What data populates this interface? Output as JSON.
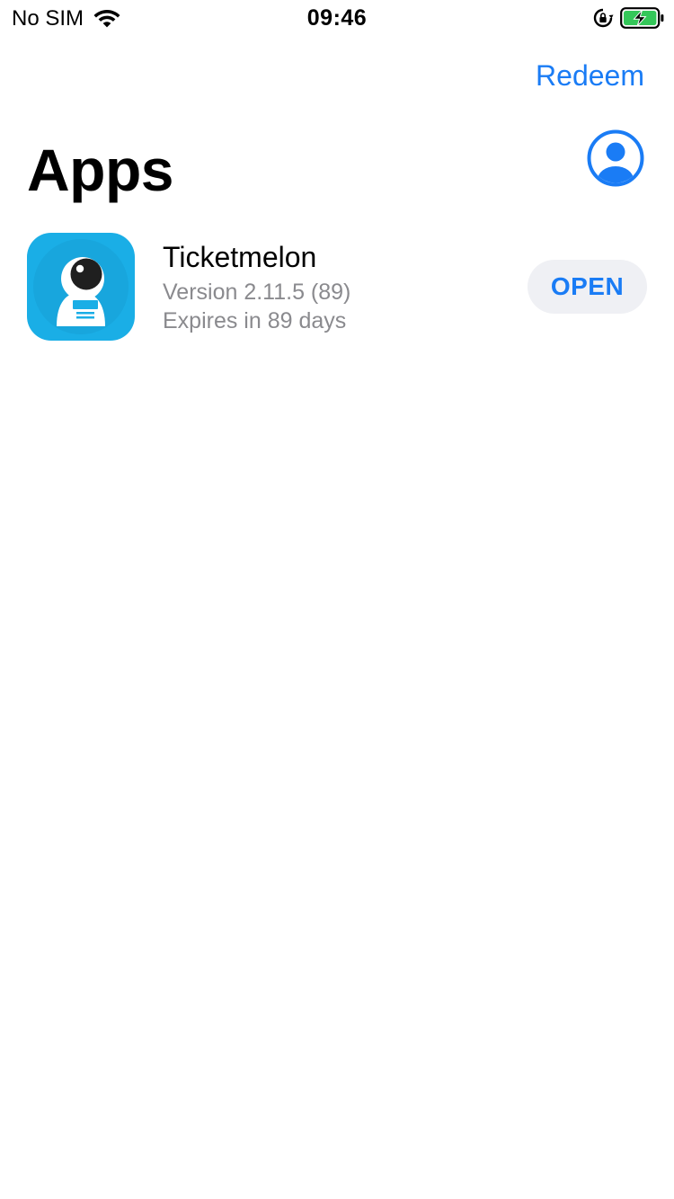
{
  "status_bar": {
    "carrier": "No SIM",
    "time": "09:46",
    "icons": [
      "wifi-icon",
      "rotation-lock-icon",
      "battery-charging-icon"
    ],
    "battery_color": "#34c759"
  },
  "nav": {
    "redeem_label": "Redeem",
    "account_icon": "account-circle-icon"
  },
  "page": {
    "title": "Apps"
  },
  "apps": [
    {
      "name": "Ticketmelon",
      "version": "Version 2.11.5 (89)",
      "expiry": "Expires in 89 days",
      "action_label": "OPEN",
      "icon": "astronaut-app-icon",
      "icon_color": "#1aaee6"
    }
  ],
  "colors": {
    "accent": "#1a7cf5",
    "secondary_text": "#8a8a8e",
    "button_bg": "#eff0f4"
  }
}
